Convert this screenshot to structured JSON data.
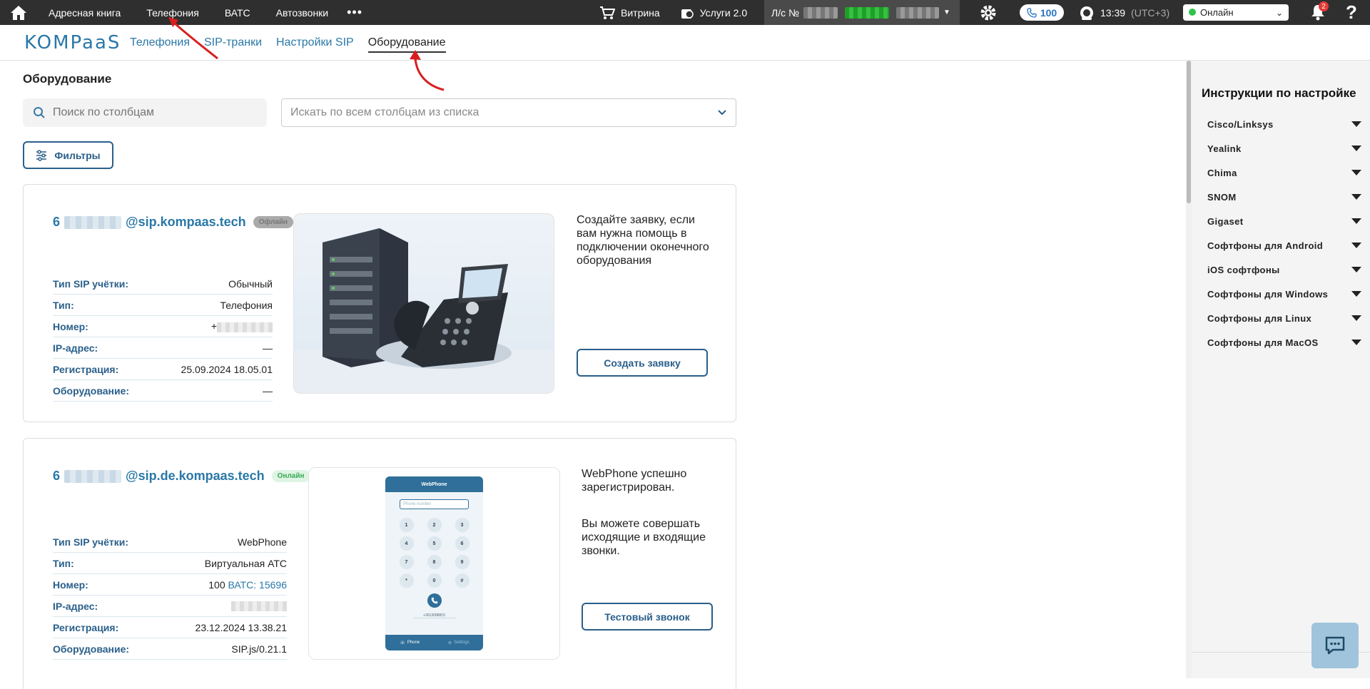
{
  "topbar": {
    "nav": [
      "Адресная книга",
      "Телефония",
      "ВАТС",
      "Автозвонки"
    ],
    "more": "•••",
    "vitrina": "Витрина",
    "services": "Услуги 2.0",
    "account_prefix": "Л/с №",
    "balance": "100",
    "time": "13:39",
    "timezone": "(UTC+3)",
    "status": "Онлайн",
    "notifications": "2",
    "help": "?"
  },
  "subnav": {
    "logo": "KOMPaaS",
    "tabs": [
      "Телефония",
      "SIP-транки",
      "Настройки SIP",
      "Оборудование"
    ],
    "active_tab": "Оборудование"
  },
  "main": {
    "title": "Оборудование",
    "search_placeholder": "Поиск по столбцам",
    "search_all": "Искать по всем столбцам из списка",
    "filters": "Фильтры"
  },
  "cards": [
    {
      "account_prefix": "6",
      "account_domain": "@sip.kompaas.tech",
      "state": "Офлайн",
      "fields": [
        {
          "label": "Тип SIP учётки:",
          "value": "Обычный"
        },
        {
          "label": "Тип:",
          "value": "Телефония"
        },
        {
          "label": "Номер:",
          "value": "+"
        },
        {
          "label": "IP-адрес:",
          "value": "—"
        },
        {
          "label": "Регистрация:",
          "value": "25.09.2024 18.05.01"
        },
        {
          "label": "Оборудование:",
          "value": "—"
        }
      ],
      "text": "Создайте заявку, если вам нужна помощь в подключении оконечного оборудования",
      "button": "Создать заявку"
    },
    {
      "account_prefix": "6",
      "account_domain": "@sip.de.kompaas.tech",
      "state": "Онлайн",
      "fields": [
        {
          "label": "Тип SIP учётки:",
          "value": "WebPhone"
        },
        {
          "label": "Тип:",
          "value": "Виртуальная АТС"
        },
        {
          "label": "Номер:",
          "value": "100",
          "link": "ВАТС: 15696"
        },
        {
          "label": "IP-адрес:",
          "value": ""
        },
        {
          "label": "Регистрация:",
          "value": "23.12.2024 13.38.21"
        },
        {
          "label": "Оборудование:",
          "value": "SIP.js/0.21.1"
        }
      ],
      "text1": "WebPhone успешно зарегистрирован.",
      "text2": "Вы можете совершать исходящие и входящие звонки.",
      "button": "Тестовый звонок",
      "webphone": {
        "title": "WebPhone",
        "placeholder": "Phone number",
        "keys": [
          "1",
          "2",
          "3",
          "4",
          "5",
          "6",
          "7",
          "8",
          "9",
          "*",
          "0",
          "#"
        ],
        "select": "+3613088815",
        "tab_phone": "Phone",
        "tab_settings": "Settings"
      }
    }
  ],
  "rpanel": {
    "title": "Инструкции по настройке",
    "items": [
      "Cisco/Linksys",
      "Yealink",
      "Chima",
      "SNOM",
      "Gigaset",
      "Софтфоны для Android",
      "iOS софтфоны",
      "Софтфоны для Windows",
      "Софтфоны для Linux",
      "Софтфоны для MacOS"
    ]
  },
  "colors": {
    "topbar": "#2f2f2f",
    "accent": "#2a78a8",
    "button": "#2a5f8a",
    "online": "#2ec44a"
  }
}
